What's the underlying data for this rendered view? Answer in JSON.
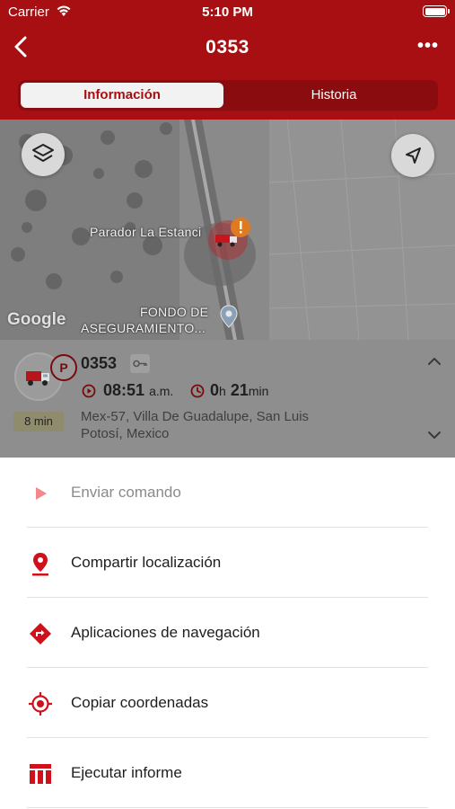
{
  "status_bar": {
    "carrier": "Carrier",
    "time": "5:10 PM"
  },
  "nav": {
    "title": "0353",
    "more": "•••"
  },
  "tabs": [
    {
      "label": "Información",
      "active": true
    },
    {
      "label": "Historia",
      "active": false
    }
  ],
  "map": {
    "places": [
      "Parador La Estanci",
      "FONDO DE",
      "ASEGURAMIENTO..."
    ],
    "logo": "Google"
  },
  "vehicle": {
    "name": "0353",
    "status_badge": "P",
    "elapsed": "8 min",
    "start_time": "08:51",
    "start_period": "a.m.",
    "duration_hours": "0",
    "duration_h_unit": "h",
    "duration_minutes": "21",
    "duration_min_unit": "min",
    "address": "Mex-57, Villa De Guadalupe, San Luis Potosí, Mexico"
  },
  "actions": [
    {
      "label": "Enviar comando",
      "icon": "play-icon",
      "enabled": false
    },
    {
      "label": "Compartir localización",
      "icon": "location-pin-icon",
      "enabled": true
    },
    {
      "label": "Aplicaciones de navegación",
      "icon": "navigation-diamond-icon",
      "enabled": true
    },
    {
      "label": "Copiar coordenadas",
      "icon": "crosshair-icon",
      "enabled": true
    },
    {
      "label": "Ejecutar informe",
      "icon": "report-table-icon",
      "enabled": true
    }
  ],
  "colors": {
    "brand": "#a70f12",
    "brand_dark": "#8b0c0f",
    "accent_icon": "#d0111b",
    "disabled_icon": "#f0888c"
  }
}
